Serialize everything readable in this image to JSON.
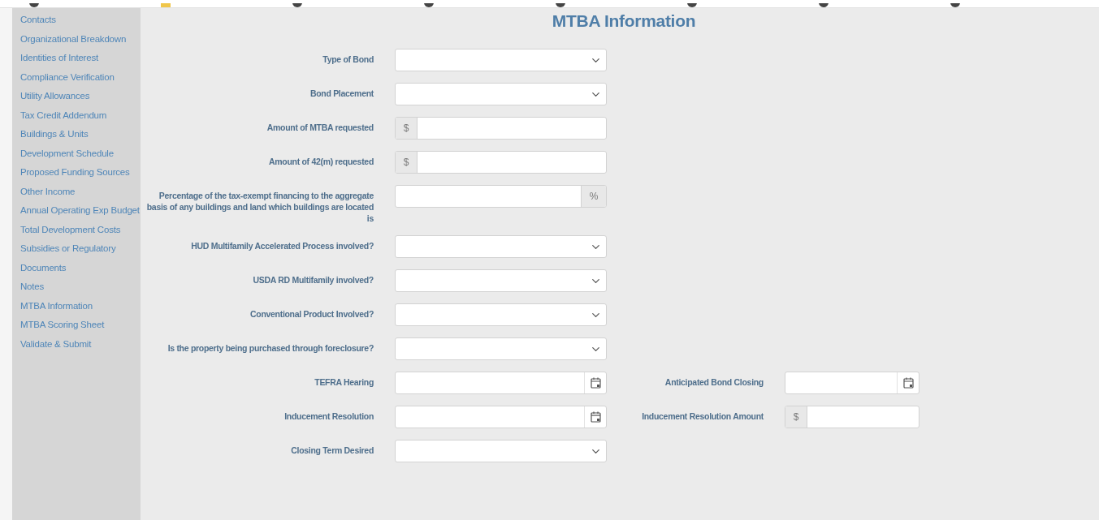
{
  "sidebar": {
    "items": [
      {
        "label": "Contacts"
      },
      {
        "label": "Organizational Breakdown"
      },
      {
        "label": "Identities of Interest"
      },
      {
        "label": "Compliance Verification"
      },
      {
        "label": "Utility Allowances"
      },
      {
        "label": "Tax Credit Addendum"
      },
      {
        "label": "Buildings & Units"
      },
      {
        "label": "Development Schedule"
      },
      {
        "label": "Proposed Funding Sources"
      },
      {
        "label": "Other Income"
      },
      {
        "label": "Annual Operating Exp Budget"
      },
      {
        "label": "Total Development Costs"
      },
      {
        "label": "Subsidies or Regulatory"
      },
      {
        "label": "Documents"
      },
      {
        "label": "Notes"
      },
      {
        "label": "MTBA Information"
      },
      {
        "label": "MTBA Scoring Sheet"
      },
      {
        "label": "Validate & Submit"
      }
    ]
  },
  "page_title": "MTBA Information",
  "form": {
    "rows": [
      {
        "fields": [
          {
            "label": "Type of Bond",
            "kind": "select"
          }
        ]
      },
      {
        "fields": [
          {
            "label": "Bond Placement",
            "kind": "select"
          }
        ]
      },
      {
        "fields": [
          {
            "label": "Amount of MTBA requested",
            "kind": "prefix",
            "addon": "$"
          }
        ]
      },
      {
        "fields": [
          {
            "label": "Amount of 42(m) requested",
            "kind": "prefix",
            "addon": "$"
          }
        ]
      },
      {
        "fields": [
          {
            "label": "Percentage of the tax-exempt financing to the aggregate basis of any buildings and land which buildings are located is",
            "kind": "suffix",
            "addon": "%"
          }
        ]
      },
      {
        "fields": [
          {
            "label": "HUD Multifamily Accelerated Process involved?",
            "kind": "select"
          }
        ]
      },
      {
        "fields": [
          {
            "label": "USDA RD Multifamily involved?",
            "kind": "select"
          }
        ]
      },
      {
        "fields": [
          {
            "label": "Conventional Product Involved?",
            "kind": "select"
          }
        ]
      },
      {
        "fields": [
          {
            "label": "Is the property being purchased through foreclosure?",
            "kind": "select"
          }
        ]
      },
      {
        "fields": [
          {
            "label": "TEFRA Hearing",
            "kind": "date"
          },
          {
            "label": "Anticipated Bond Closing",
            "kind": "date"
          }
        ]
      },
      {
        "fields": [
          {
            "label": "Inducement Resolution",
            "kind": "date"
          },
          {
            "label": "Inducement Resolution Amount",
            "kind": "prefix",
            "addon": "$"
          }
        ]
      },
      {
        "fields": [
          {
            "label": "Closing Term Desired",
            "kind": "select"
          }
        ]
      }
    ]
  }
}
